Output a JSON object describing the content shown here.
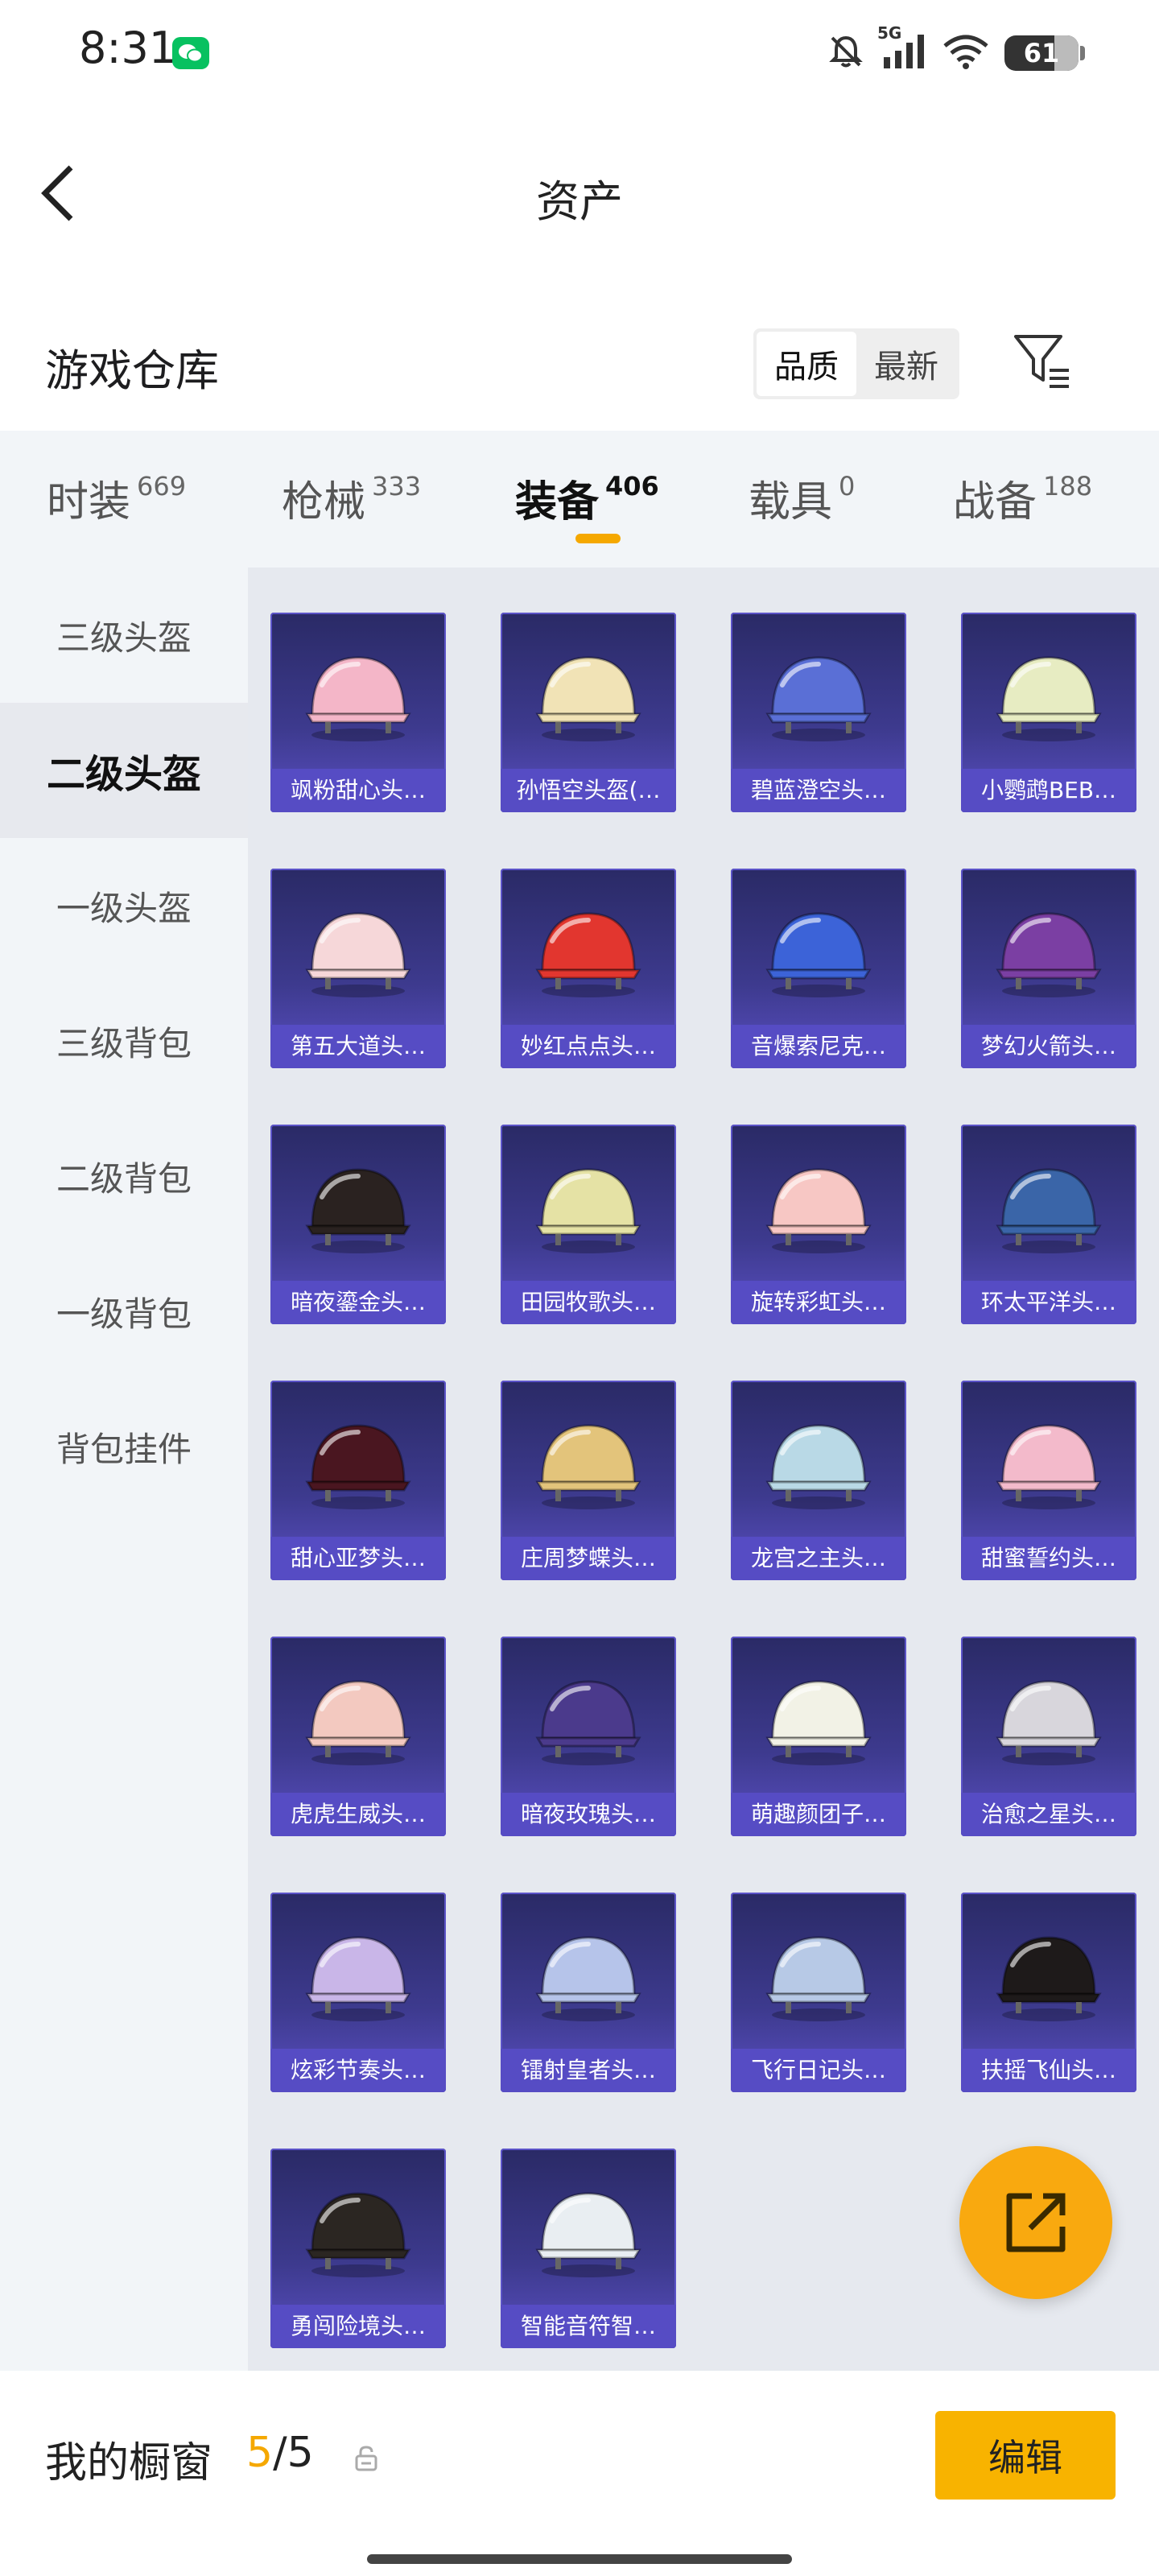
{
  "status_bar": {
    "time": "8:31",
    "network": "5G",
    "battery": "61"
  },
  "nav": {
    "title": "资产"
  },
  "warehouse": {
    "title": "游戏仓库",
    "sort_options": [
      "品质",
      "最新"
    ],
    "active_sort": "品质"
  },
  "categories": [
    {
      "label": "时装",
      "count": "669"
    },
    {
      "label": "枪械",
      "count": "333"
    },
    {
      "label": "装备",
      "count": "406"
    },
    {
      "label": "载具",
      "count": "0"
    },
    {
      "label": "战备",
      "count": "188"
    }
  ],
  "active_category": "装备",
  "sidebar": {
    "items": [
      "三级头盔",
      "二级头盔",
      "一级头盔",
      "三级背包",
      "二级背包",
      "一级背包",
      "背包挂件"
    ],
    "active": "二级头盔"
  },
  "items": [
    {
      "name": "飒粉甜心头…",
      "icon": "helmet-icon",
      "color": "#f4b6c8"
    },
    {
      "name": "孙悟空头盔(…",
      "icon": "helmet-icon",
      "color": "#f1e3b6"
    },
    {
      "name": "碧蓝澄空头…",
      "icon": "helmet-icon",
      "color": "#5a6fd6"
    },
    {
      "name": "小鹦鹉BEB…",
      "icon": "helmet-icon",
      "color": "#e7ecc2"
    },
    {
      "name": "第五大道头…",
      "icon": "helmet-icon",
      "color": "#f6d7d9"
    },
    {
      "name": "妙红点点头…",
      "icon": "helmet-icon",
      "color": "#e2362f"
    },
    {
      "name": "音爆索尼克…",
      "icon": "helmet-icon",
      "color": "#3c63d8"
    },
    {
      "name": "梦幻火箭头…",
      "icon": "helmet-icon",
      "color": "#7b3fa3"
    },
    {
      "name": "暗夜鎏金头…",
      "icon": "helmet-icon",
      "color": "#2a2220"
    },
    {
      "name": "田园牧歌头…",
      "icon": "helmet-icon",
      "color": "#e5e2a5"
    },
    {
      "name": "旋转彩虹头…",
      "icon": "helmet-icon",
      "color": "#f7c7c4"
    },
    {
      "name": "环太平洋头…",
      "icon": "helmet-icon",
      "color": "#3a65a8"
    },
    {
      "name": "甜心亚梦头…",
      "icon": "helmet-icon",
      "color": "#4a1620"
    },
    {
      "name": "庄周梦蝶头…",
      "icon": "helmet-icon",
      "color": "#e3c47b"
    },
    {
      "name": "龙宫之主头…",
      "icon": "helmet-icon",
      "color": "#b9d9e6"
    },
    {
      "name": "甜蜜誓约头…",
      "icon": "helmet-icon",
      "color": "#f3bacb"
    },
    {
      "name": "虎虎生威头…",
      "icon": "helmet-icon",
      "color": "#f3c9c0"
    },
    {
      "name": "暗夜玫瑰头…",
      "icon": "helmet-icon",
      "color": "#4b3a8c"
    },
    {
      "name": "萌趣颜团子…",
      "icon": "helmet-icon",
      "color": "#f2f2e6"
    },
    {
      "name": "治愈之星头…",
      "icon": "helmet-icon",
      "color": "#d8d6dc"
    },
    {
      "name": "炫彩节奏头…",
      "icon": "helmet-icon",
      "color": "#c9b6e8"
    },
    {
      "name": "镭射皇者头…",
      "icon": "helmet-icon",
      "color": "#b6c4ea"
    },
    {
      "name": "飞行日记头…",
      "icon": "helmet-icon",
      "color": "#b7c9e6"
    },
    {
      "name": "扶摇飞仙头…",
      "icon": "helmet-icon",
      "color": "#1e1a1a"
    },
    {
      "name": "勇闯险境头…",
      "icon": "helmet-icon",
      "color": "#2b2622"
    },
    {
      "name": "智能音符智…",
      "icon": "helmet-icon",
      "color": "#e9eef2"
    }
  ],
  "fab": {
    "icon": "share-icon"
  },
  "showcase": {
    "label": "我的橱窗",
    "current": "5",
    "separator": "/",
    "total": "5",
    "lock_icon": "lock-icon"
  },
  "edit_button": "编辑",
  "colors": {
    "accent": "#f5a800",
    "card_bg": "#3d3a8e",
    "card_label_bg": "#564cc4"
  }
}
